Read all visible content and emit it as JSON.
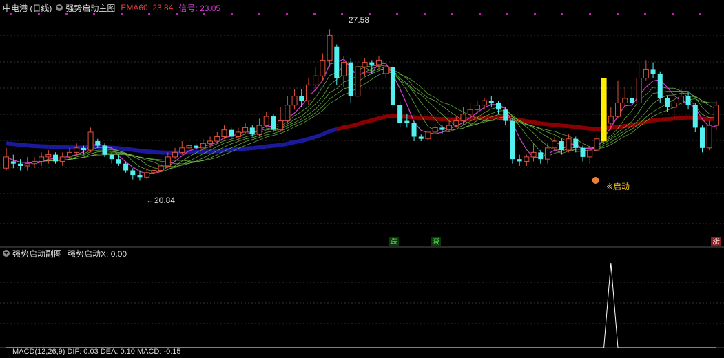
{
  "main_panel": {
    "stock": "中电港 (日线)",
    "indicator": "强势启动主图",
    "ema_label": "EMA60: 23.84",
    "signal_label": "信号: 23.05",
    "high_label": "27.58",
    "low_label": "←20.84",
    "start_label": "※启动",
    "markers": {
      "die": "跌",
      "jian": "減",
      "zhang": "涨"
    }
  },
  "sub_panel": {
    "indicator": "强势启动副图",
    "value_label": "强势启动X: 0.00"
  },
  "bottom_panel": {
    "partial_label": "MACD(12,26,9) DIF: 0.03 DEA: 0.10 MACD: -0.15"
  },
  "colors": {
    "background": "#000000",
    "up_candle": "#e0523a",
    "down_candle": "#54f0f0",
    "ema_red": "#8b0000",
    "ema_blue": "#1a1a9a",
    "signal_line": "#d040d0",
    "yellow_bar": "#ffee00"
  },
  "chart_data": {
    "type": "candlestick",
    "price_high": 27.58,
    "price_low": 20.84,
    "ema60_last": 23.84,
    "signal_last": 23.05,
    "subchart_x_last": 0.0,
    "ohlc": [
      [
        21.4,
        21.9,
        21.3,
        22.3
      ],
      [
        21.7,
        21.6,
        21.4,
        22.0
      ],
      [
        21.6,
        21.5,
        21.3,
        21.8
      ],
      [
        21.5,
        21.6,
        21.3,
        21.9
      ],
      [
        21.6,
        21.7,
        21.4,
        21.9
      ],
      [
        21.7,
        21.9,
        21.5,
        22.1
      ],
      [
        21.9,
        22.0,
        21.6,
        22.2
      ],
      [
        22.0,
        21.7,
        21.6,
        22.1
      ],
      [
        21.7,
        21.9,
        21.5,
        22.1
      ],
      [
        21.9,
        22.1,
        21.8,
        22.3
      ],
      [
        22.1,
        22.3,
        22.0,
        22.5
      ],
      [
        22.3,
        22.2,
        22.0,
        22.4
      ],
      [
        22.2,
        23.0,
        22.1,
        23.2
      ],
      [
        22.6,
        22.4,
        22.3,
        22.7
      ],
      [
        22.4,
        22.0,
        21.9,
        22.5
      ],
      [
        22.0,
        21.8,
        21.6,
        22.1
      ],
      [
        21.8,
        21.6,
        21.5,
        22.0
      ],
      [
        21.6,
        21.3,
        21.2,
        21.7
      ],
      [
        21.3,
        21.1,
        20.9,
        21.4
      ],
      [
        21.1,
        21.0,
        20.84,
        21.3
      ],
      [
        21.0,
        21.2,
        20.9,
        21.4
      ],
      [
        21.2,
        21.3,
        21.0,
        21.5
      ],
      [
        21.3,
        21.5,
        21.2,
        21.8
      ],
      [
        21.5,
        21.9,
        21.4,
        22.1
      ],
      [
        21.9,
        22.1,
        21.8,
        22.3
      ],
      [
        22.1,
        22.3,
        22.0,
        22.6
      ],
      [
        22.3,
        22.4,
        22.1,
        22.7
      ],
      [
        22.4,
        22.3,
        22.2,
        22.5
      ],
      [
        22.3,
        22.5,
        22.2,
        22.7
      ],
      [
        22.5,
        22.6,
        22.3,
        22.8
      ],
      [
        22.6,
        22.8,
        22.5,
        23.0
      ],
      [
        22.8,
        23.1,
        22.7,
        23.3
      ],
      [
        23.1,
        22.8,
        22.7,
        23.2
      ],
      [
        22.8,
        23.0,
        22.6,
        23.2
      ],
      [
        23.0,
        23.2,
        22.9,
        23.4
      ],
      [
        23.2,
        22.9,
        22.8,
        23.3
      ],
      [
        22.9,
        23.3,
        22.8,
        23.6
      ],
      [
        23.3,
        23.7,
        23.2,
        23.9
      ],
      [
        23.7,
        23.1,
        23.0,
        23.8
      ],
      [
        23.1,
        23.5,
        23.0,
        24.1
      ],
      [
        23.5,
        24.2,
        23.4,
        24.6
      ],
      [
        24.2,
        24.6,
        24.0,
        24.9
      ],
      [
        24.6,
        24.4,
        24.1,
        24.9
      ],
      [
        24.4,
        25.1,
        24.2,
        25.4
      ],
      [
        25.1,
        25.5,
        24.9,
        25.9
      ],
      [
        25.5,
        26.2,
        25.3,
        26.5
      ],
      [
        26.2,
        27.3,
        25.9,
        27.58
      ],
      [
        26.8,
        25.4,
        25.1,
        26.9
      ],
      [
        25.5,
        26.1,
        25.0,
        26.4
      ],
      [
        26.1,
        24.6,
        24.3,
        26.3
      ],
      [
        24.6,
        25.9,
        24.5,
        26.2
      ],
      [
        25.9,
        26.1,
        25.5,
        26.3
      ],
      [
        26.1,
        26.0,
        25.6,
        26.2
      ],
      [
        26.0,
        26.2,
        25.8,
        26.4
      ],
      [
        25.6,
        25.9,
        25.4,
        26.0
      ],
      [
        25.9,
        24.2,
        24.0,
        26.0
      ],
      [
        24.2,
        23.4,
        23.2,
        24.4
      ],
      [
        23.5,
        23.4,
        23.2,
        23.8
      ],
      [
        23.4,
        22.8,
        22.6,
        23.5
      ],
      [
        22.8,
        22.7,
        22.6,
        22.9
      ],
      [
        22.7,
        23.0,
        22.6,
        23.3
      ],
      [
        23.0,
        23.2,
        22.9,
        23.4
      ],
      [
        23.2,
        23.1,
        22.9,
        23.3
      ],
      [
        23.1,
        23.3,
        23.0,
        23.5
      ],
      [
        23.3,
        23.5,
        23.2,
        23.7
      ],
      [
        23.5,
        23.8,
        23.3,
        24.1
      ],
      [
        23.8,
        24.0,
        23.6,
        24.3
      ],
      [
        24.0,
        24.2,
        23.8,
        24.4
      ],
      [
        24.2,
        24.4,
        24.0,
        24.5
      ],
      [
        24.4,
        24.3,
        24.1,
        24.6
      ],
      [
        24.3,
        24.0,
        23.8,
        24.4
      ],
      [
        24.0,
        23.5,
        23.3,
        24.1
      ],
      [
        23.5,
        21.8,
        21.6,
        23.6
      ],
      [
        21.8,
        21.7,
        21.5,
        22.0
      ],
      [
        21.7,
        21.9,
        21.5,
        22.0
      ],
      [
        21.9,
        22.1,
        21.7,
        22.5
      ],
      [
        22.1,
        21.8,
        21.6,
        22.2
      ],
      [
        21.8,
        22.3,
        21.6,
        22.5
      ],
      [
        22.3,
        22.6,
        22.2,
        22.8
      ],
      [
        22.6,
        22.2,
        22.0,
        22.7
      ],
      [
        22.2,
        22.7,
        22.1,
        22.9
      ],
      [
        22.7,
        22.3,
        22.1,
        22.8
      ],
      [
        22.3,
        21.9,
        21.7,
        22.4
      ],
      [
        21.9,
        22.2,
        21.6,
        22.4
      ],
      [
        22.2,
        22.7,
        22.1,
        23.0
      ],
      [
        22.6,
        24.2,
        22.5,
        24.2
      ],
      [
        23.4,
        23.7,
        23.1,
        24.1
      ],
      [
        23.7,
        24.3,
        23.6,
        25.3
      ],
      [
        24.3,
        24.5,
        24.1,
        25.0
      ],
      [
        24.5,
        24.3,
        24.1,
        25.1
      ],
      [
        24.3,
        25.4,
        24.2,
        26.1
      ],
      [
        25.4,
        25.8,
        25.3,
        26.2
      ],
      [
        25.8,
        25.6,
        25.4,
        26.1
      ],
      [
        25.6,
        24.5,
        24.3,
        25.7
      ],
      [
        24.5,
        24.1,
        23.9,
        24.6
      ],
      [
        24.1,
        24.3,
        23.6,
        24.4
      ],
      [
        24.3,
        24.6,
        24.2,
        24.9
      ],
      [
        24.6,
        24.2,
        24.0,
        24.8
      ],
      [
        24.2,
        23.2,
        23.0,
        24.3
      ],
      [
        23.2,
        22.3,
        22.1,
        23.3
      ],
      [
        22.3,
        23.3,
        22.2,
        23.5
      ],
      [
        23.3,
        24.2,
        23.1,
        24.4
      ]
    ],
    "subchart_values": [
      0,
      0,
      0,
      0,
      0,
      0,
      0,
      0,
      0,
      0,
      0,
      0,
      0,
      0,
      0,
      0,
      0,
      0,
      0,
      0,
      0,
      0,
      0,
      0,
      0,
      0,
      0,
      0,
      0,
      0,
      0,
      0,
      0,
      0,
      0,
      0,
      0,
      0,
      0,
      0,
      0,
      0,
      0,
      0,
      0,
      0,
      0,
      0,
      0,
      0,
      0,
      0,
      0,
      0,
      0,
      0,
      0,
      0,
      0,
      0,
      0,
      0,
      0,
      0,
      0,
      0,
      0,
      0,
      0,
      0,
      0,
      0,
      0,
      0,
      0,
      0,
      0,
      0,
      0,
      0,
      0,
      0,
      0,
      0,
      0,
      0,
      1,
      0,
      0,
      0,
      0,
      0,
      0,
      0,
      0,
      0,
      0,
      0,
      0,
      0,
      0,
      0
    ]
  }
}
